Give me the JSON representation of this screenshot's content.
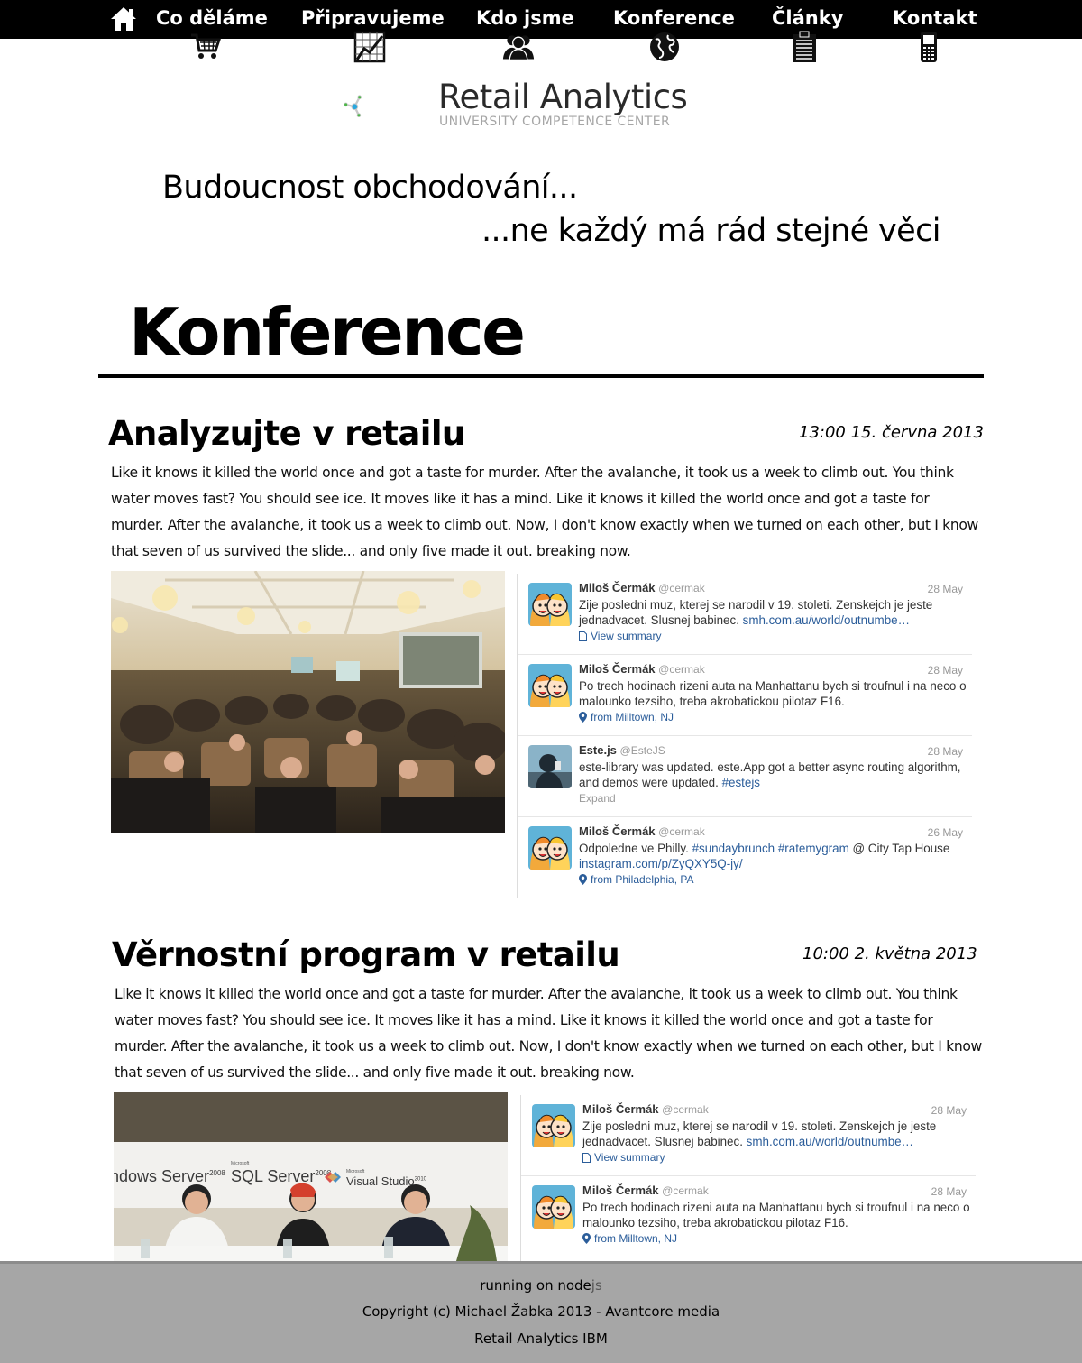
{
  "nav": {
    "items": [
      {
        "label": "Co děláme",
        "icon": "cart-icon"
      },
      {
        "label": "Připravujeme",
        "icon": "chart-icon"
      },
      {
        "label": "Kdo jsme",
        "icon": "users-icon"
      },
      {
        "label": "Konference",
        "icon": "globe-icon"
      },
      {
        "label": "Články",
        "icon": "document-icon"
      },
      {
        "label": "Kontakt",
        "icon": "phone-icon"
      }
    ],
    "home_icon": "home-icon"
  },
  "logo": {
    "title": "Retail Analytics",
    "subtitle": "UNIVERSITY COMPETENCE CENTER",
    "colors": {
      "blue": "#29a7de",
      "green": "#4cb748",
      "grey": "#c8c8c8"
    }
  },
  "tagline": {
    "line1": "Budoucnost obchodování...",
    "line2": "...ne každý má rád stejné věci"
  },
  "page_title": "Konference",
  "articles": [
    {
      "title": "Analyzujte v retailu",
      "date": "13:00 15. června 2013",
      "body": "Like it knows it killed the world once and got a taste for murder. After the avalanche, it took us a week to climb out. You think water moves fast? You should see ice. It moves like it has a mind. Like it knows it killed the world once and got a taste for murder. After the avalanche, it took us a week to climb out. Now, I don't know exactly when we turned on each other, but I know that seven of us survived the slide... and only five made it out. breaking now.",
      "tweets": [
        {
          "name": "Miloš Čermák",
          "handle": "@cermak",
          "date": "28 May",
          "text": "Zije posledni muz, kterej se narodil v 19. stoleti. Zenskejch je jeste jednadvacet. Slusnej babinec. ",
          "link": "smh.com.au/world/outnumbe…",
          "meta": "View summary",
          "meta_type": "summary"
        },
        {
          "name": "Miloš Čermák",
          "handle": "@cermak",
          "date": "28 May",
          "text": "Po trech hodinach rizeni auta na Manhattanu bych si troufnul i na neco o malounko tezsiho, treba akrobatickou pilotaz F16.",
          "link": "",
          "meta": "from Milltown, NJ",
          "meta_type": "location"
        },
        {
          "name": "Este.js",
          "handle": "@EsteJS",
          "date": "28 May",
          "text": "este-library was updated. este.App got a better async routing algorithm, and demos were updated. ",
          "link": "#estejs",
          "meta": "Expand",
          "meta_type": "expand"
        },
        {
          "name": "Miloš Čermák",
          "handle": "@cermak",
          "date": "26 May",
          "text": "Odpoledne ve Philly. ",
          "link": "#sundaybrunch #ratemygram",
          "text_after": " @ City Tap House",
          "link2": "instagram.com/p/ZyQXY5Q-jy/",
          "meta": "from Philadelphia, PA",
          "meta_type": "location"
        }
      ]
    },
    {
      "title": "Věrnostní program v retailu",
      "date": "10:00 2. května 2013",
      "body": "Like it knows it killed the world once and got a taste for murder. After the avalanche, it took us a week to climb out. You think water moves fast? You should see ice. It moves like it has a mind. Like it knows it killed the world once and got a taste for murder. After the avalanche, it took us a week to climb out. Now, I don't know exactly when we turned on each other, but I know that seven of us survived the slide... and only five made it out. breaking now.",
      "photo_banner": {
        "left": "ndows Server",
        "left_sup": "2008",
        "mid_small": "Microsoft",
        "mid": "SQL Server",
        "mid_sup": "2008",
        "right_small": "Microsoft",
        "right": "Visual Studio",
        "right_sup": "2010"
      },
      "tweets": [
        {
          "name": "Miloš Čermák",
          "handle": "@cermak",
          "date": "28 May",
          "text": "Zije posledni muz, kterej se narodil v 19. stoleti. Zenskejch je jeste jednadvacet. Slusnej babinec. ",
          "link": "smh.com.au/world/outnumbe…",
          "meta": "View summary",
          "meta_type": "summary"
        },
        {
          "name": "Miloš Čermák",
          "handle": "@cermak",
          "date": "28 May",
          "text": "Po trech hodinach rizeni auta na Manhattanu bych si troufnul i na neco o malounko tezsiho, treba akrobatickou pilotaz F16.",
          "link": "",
          "meta": "from Milltown, NJ",
          "meta_type": "location"
        }
      ]
    }
  ],
  "footer": {
    "line1_a": "running on node",
    "line1_b": "js",
    "line2": "Copyright (c) Michael Žabka 2013 - Avantcore media",
    "line3": "Retail Analytics IBM"
  }
}
